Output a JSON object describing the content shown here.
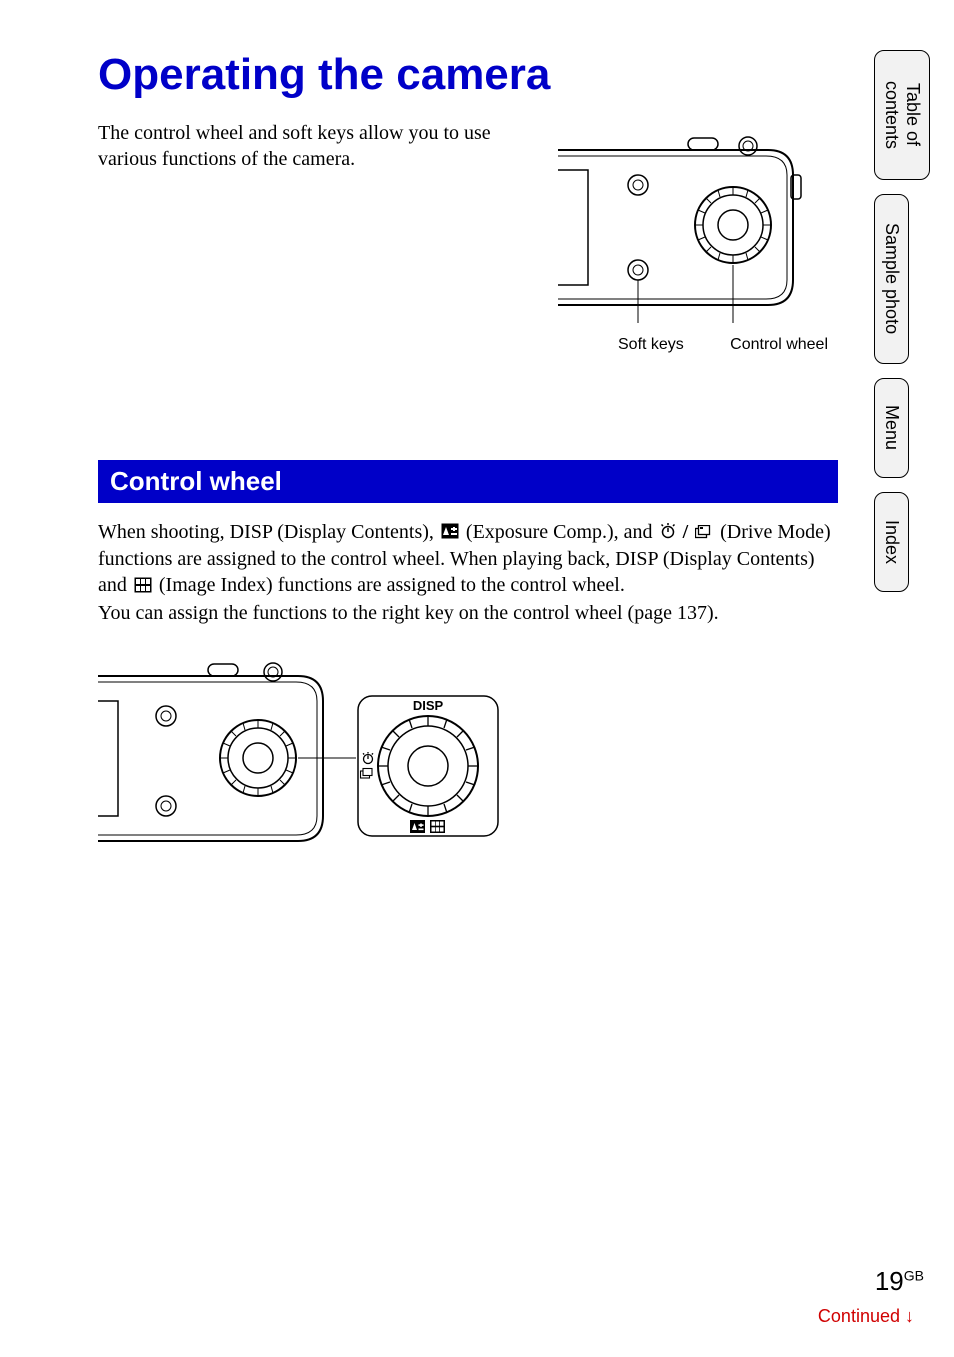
{
  "page_title": "Operating the camera",
  "intro": "The control wheel and soft keys allow you to use various functions of the camera.",
  "figure_top": {
    "label_left": "Soft keys",
    "label_right": "Control wheel"
  },
  "section_heading": "Control wheel",
  "body": {
    "p1a": "When shooting, DISP (Display Contents), ",
    "p1b": " (Exposure Comp.), and ",
    "p1c": " (Drive Mode) functions are assigned to the control wheel. When playing back, DISP (Display Contents) and ",
    "p1d": " (Image Index) functions are assigned to the control wheel.",
    "p2": "You can assign the functions to the right key on the control wheel (page 137)."
  },
  "tabs": {
    "toc": "Table of\ncontents",
    "sample": "Sample photo",
    "menu": "Menu",
    "index": "Index"
  },
  "page_number": "19",
  "page_suffix": "GB",
  "continued": "Continued ",
  "continued_arrow": "↓"
}
